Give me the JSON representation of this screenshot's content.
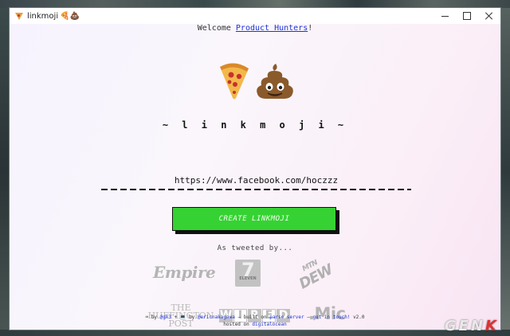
{
  "window": {
    "title": "linkmoji",
    "title_emoji": "🍕💩",
    "controls": [
      "minimize",
      "maximize",
      "close"
    ]
  },
  "welcome": {
    "prefix": "Welcome ",
    "link": "Product Hunters",
    "suffix": "!"
  },
  "hero": {
    "emojis": [
      "pizza",
      "pile-of-poo"
    ],
    "brand": "~ l i n k m o j i ~"
  },
  "url_input": {
    "value": "https://www.facebook.com/hoczzz"
  },
  "create_button": {
    "label": "CREATE LINKMOJI"
  },
  "press": {
    "heading": "As tweeted by...",
    "logos": {
      "empire": "Empire",
      "seven_eleven": "7",
      "seven_eleven_sub": "ELEVEN",
      "mtn_dew_top": "MTN",
      "mtn_dew": "DEW",
      "huffington": [
        "THE",
        "HUFFINGTON",
        "POST"
      ],
      "wired": [
        "W",
        "I",
        "R",
        "E",
        "D"
      ],
      "mic": ".Mic"
    }
  },
  "footer": {
    "by1": "by",
    "link1": "@gk3",
    "by2": "by",
    "link2": "@ericnakagawa",
    "built": "— built on",
    "link3": "parse server",
    "dash": "—",
    "link4": "get in touch!",
    "version": "v2.0",
    "hosted": "hosted on",
    "link5": "digitalocean"
  },
  "watermark": {
    "text_main": "GEN",
    "text_accent": "K"
  },
  "colors": {
    "button_green": "#36d233",
    "link_blue": "#1a35d6",
    "logo_gray": "#b7b7b7"
  }
}
